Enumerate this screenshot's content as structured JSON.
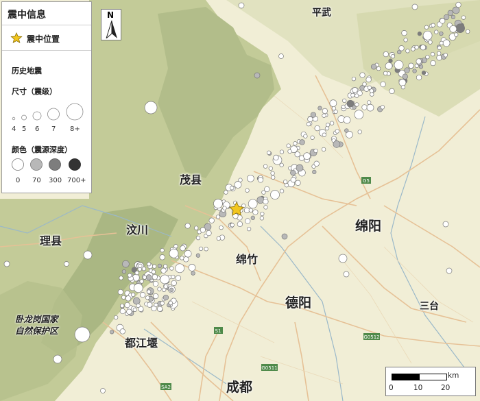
{
  "legend": {
    "title": "震中信息",
    "epicenter_label": "震中位置",
    "history_label": "历史地震",
    "size_label": "尺寸（震级）",
    "size_ticks": [
      "4",
      "5",
      "6",
      "7",
      "8+"
    ],
    "color_label": "颜色（震源深度）",
    "color_ticks": [
      "0",
      "70",
      "300",
      "700+"
    ],
    "depth_colors": [
      "#ffffff",
      "#b8b8b8",
      "#7d7d7d",
      "#333333"
    ]
  },
  "compass": {
    "label": "N"
  },
  "scale_bar": {
    "unit": "km",
    "ticks": [
      "0",
      "10",
      "20"
    ]
  },
  "places": {
    "pingwu": "平武",
    "maoxian": "茂县",
    "wenchuan": "汶川",
    "lixian": "理县",
    "mianzhu": "绵竹",
    "mianyang": "绵阳",
    "deyang": "德阳",
    "santai": "三台",
    "dujiangyan": "都江堰",
    "chengdu": "成都",
    "reserve_line1": "卧龙岗国家",
    "reserve_line2": "自然保护区"
  },
  "roads": [
    "G5",
    "S1",
    "G0512",
    "G0511",
    "SA2"
  ],
  "colors": {
    "plain": "#f1eed6",
    "mountain": "#c8cf9f",
    "forest": "#b4bf8c",
    "road": "#e9c59d",
    "river": "#9ab8c9",
    "epicenter": "#f2c61f"
  }
}
